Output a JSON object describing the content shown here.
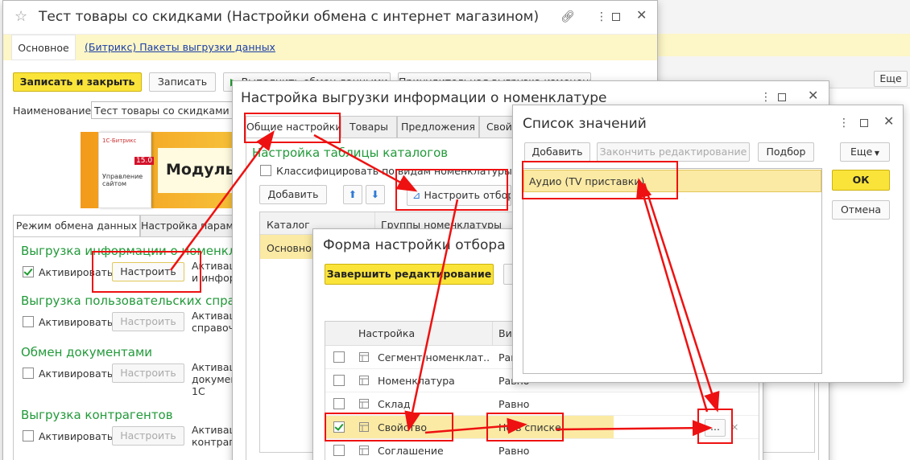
{
  "bg": {
    "bar_btn": "Еще"
  },
  "main": {
    "title": "Тест товары со скидками (Настройки обмена с интернет магазином)",
    "nav": [
      "Основное",
      "(Битрикс) Пакеты выгрузки данных"
    ],
    "btn_save_close": "Записать и закрыть",
    "btn_save": "Записать",
    "btn_run": "Выполнить обмен данными",
    "btn_extra": "Принудительная выгрузка изменений",
    "name_label": "Наименование:",
    "name_value": "Тест товары со скидками",
    "banner": {
      "box_title": "Управление сайтом",
      "box_version": "15.0",
      "box_brand": "1С-Битрикс",
      "text": "Модуль"
    },
    "tabs": [
      "Режим обмена данных",
      "Настройка параметров"
    ],
    "sections": [
      {
        "title": "Выгрузка информации о номенклатуре",
        "check": "Активировать",
        "checked": true,
        "button": "Настроить",
        "desc": [
          "Активация",
          "и информ"
        ]
      },
      {
        "title": "Выгрузка пользовательских справочников",
        "check": "Активировать",
        "checked": false,
        "button": "Настроить",
        "desc": [
          "Активация",
          "справочн"
        ]
      },
      {
        "title": "Обмен документами",
        "check": "Активировать",
        "checked": false,
        "button": "Настроить",
        "desc": [
          "Активация",
          "документ",
          "1С"
        ]
      },
      {
        "title": "Выгрузка контрагентов",
        "check": "Активировать",
        "checked": false,
        "button": "Настроить",
        "desc": [
          "Активация",
          "контраген"
        ]
      }
    ]
  },
  "nomen": {
    "title": "Настройка выгрузки информации о номенклатуре",
    "tabs": [
      "Общие настройки",
      "Товары",
      "Предложения",
      "Свойства"
    ],
    "section": "Настройка таблицы каталогов",
    "check": "Классифицировать по видам номенклатуры",
    "btn_add": "Добавить",
    "btn_filter": "Настроить отбор",
    "cols": [
      "Каталог",
      "Группы номенклатуры"
    ],
    "row": "Основной"
  },
  "filter": {
    "title": "Форма настройки отбора",
    "btn_finish": "Завершить редактирование",
    "cols": [
      "Настройка",
      "Вид"
    ],
    "rows": [
      {
        "name": "Сегмент номенклат...",
        "cond": "Равно",
        "checked": false
      },
      {
        "name": "Номенклатура",
        "cond": "Равно",
        "checked": false
      },
      {
        "name": "Склад",
        "cond": "Равно",
        "checked": false
      },
      {
        "name": "Свойство",
        "cond": "Не в списке",
        "checked": true
      },
      {
        "name": "Соглашение",
        "cond": "Равно",
        "checked": false
      }
    ],
    "ellipsis": "...",
    "x_mark": "×"
  },
  "list": {
    "title": "Список значений",
    "btn_add": "Добавить",
    "btn_finish": "Закончить редактирование",
    "btn_pick": "Подбор",
    "btn_more": "Еще",
    "value": "Аудио (TV приставки)",
    "btn_ok": "ОК",
    "btn_cancel": "Отмена"
  },
  "colors": {
    "accent_yellow": "#fae43a",
    "section_green": "#229a3a",
    "highlight_red": "#e11111"
  }
}
